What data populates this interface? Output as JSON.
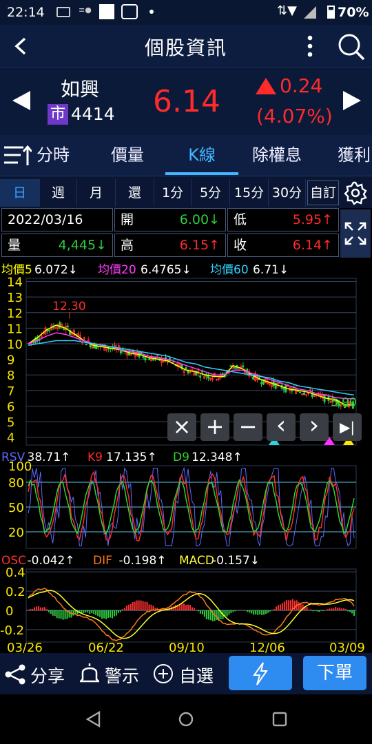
{
  "statusbar": {
    "time": "22:14",
    "battery": "70%"
  },
  "header": {
    "title": "個股資訊"
  },
  "stock": {
    "name": "如興",
    "market": "市",
    "code": "4414",
    "price": "6.14",
    "change": "0.24",
    "change_pct": "(4.07%)"
  },
  "tabs": [
    "分時",
    "價量",
    "K線",
    "除權息",
    "獲利"
  ],
  "period_tabs": [
    "日",
    "週",
    "月",
    "還",
    "1分",
    "5分",
    "15分",
    "30分"
  ],
  "custom_label": "自訂",
  "info": {
    "date": "2022/03/16",
    "open_label": "開",
    "open": "6.00↓",
    "low_label": "低",
    "low": "5.95↑",
    "vol_label": "量",
    "vol": "4,445↓",
    "high_label": "高",
    "high": "6.15↑",
    "close_label": "收",
    "close": "6.14↑"
  },
  "ma_legend": [
    {
      "label": "均價5",
      "value": "6.072↓",
      "color": "#ffff00"
    },
    {
      "label": "均價20",
      "value": "6.4765↓",
      "color": "#ff3cff"
    },
    {
      "label": "均價60",
      "value": "6.71↓",
      "color": "#30d0ff"
    }
  ],
  "kd_legend": [
    {
      "label": "RSV",
      "value": "38.71↑",
      "color": "#5b6bff"
    },
    {
      "label": "K9",
      "value": "17.135↑",
      "color": "#ff2b2b"
    },
    {
      "label": "D9",
      "value": "12.348↑",
      "color": "#2bd62b"
    }
  ],
  "macd_legend": [
    {
      "label": "OSC",
      "value": "-0.042↑",
      "color": "#ff3030"
    },
    {
      "label": "DIF",
      "value": "-0.198↑",
      "color": "#ff7a1a"
    },
    {
      "label": "MACD",
      "value": "-0.157↓",
      "color": "#ffff30"
    }
  ],
  "colors": {
    "up": "#ff2b2b",
    "down": "#2ecc40",
    "accent": "#2a8cff"
  },
  "chart_data": {
    "type": "candlestick",
    "price_axis": {
      "ticks": [
        4,
        5,
        6,
        7,
        8,
        9,
        10,
        11,
        12,
        13,
        14
      ],
      "ylim": [
        3.5,
        14.2
      ]
    },
    "annotations": [
      {
        "text": "12.30",
        "value": 12.3
      },
      {
        "text": "5.90",
        "value": 5.9
      }
    ],
    "x_ticks": [
      "03/26",
      "06/22",
      "09/10",
      "12/06",
      "03/09"
    ],
    "ma_series": [
      {
        "name": "均價5",
        "values": [
          10.0,
          10.4,
          10.9,
          11.2,
          11.0,
          10.6,
          10.2,
          9.9,
          9.8,
          9.7,
          9.6,
          9.4,
          9.3,
          9.1,
          9.0,
          8.9,
          8.6,
          8.3,
          8.2,
          8.0,
          7.9,
          7.9,
          8.6,
          8.4,
          8.0,
          7.7,
          7.5,
          7.3,
          7.1,
          7.0,
          6.9,
          6.7,
          6.5,
          6.4,
          6.1,
          6.05
        ]
      },
      {
        "name": "均價20",
        "values": [
          10.0,
          10.2,
          10.5,
          10.7,
          10.6,
          10.4,
          10.2,
          10.0,
          9.9,
          9.8,
          9.6,
          9.5,
          9.4,
          9.2,
          9.1,
          9.0,
          8.8,
          8.6,
          8.4,
          8.2,
          8.0,
          8.0,
          8.3,
          8.3,
          8.1,
          7.9,
          7.7,
          7.5,
          7.3,
          7.1,
          7.0,
          6.8,
          6.7,
          6.55,
          6.48,
          6.47
        ]
      },
      {
        "name": "均價60",
        "values": [
          9.9,
          10.0,
          10.1,
          10.2,
          10.2,
          10.2,
          10.1,
          10.0,
          9.9,
          9.8,
          9.7,
          9.6,
          9.5,
          9.4,
          9.3,
          9.2,
          9.0,
          8.8,
          8.7,
          8.5,
          8.4,
          8.3,
          8.2,
          8.1,
          8.0,
          7.9,
          7.8,
          7.6,
          7.5,
          7.3,
          7.2,
          7.1,
          7.0,
          6.9,
          6.8,
          6.71
        ]
      }
    ],
    "kd_axis": {
      "ticks": [
        20,
        50,
        80,
        100
      ],
      "ylim": [
        0,
        100
      ]
    },
    "macd_axis": {
      "ticks": [
        -0.2,
        0,
        0.2,
        0.4
      ],
      "ylim": [
        -0.33,
        0.43
      ]
    }
  },
  "chart_buttons": [
    "×",
    "+",
    "−",
    "‹",
    "›",
    "▶|"
  ],
  "bottom": {
    "share": "分享",
    "alert": "警示",
    "watch": "自選",
    "order": "下單"
  }
}
